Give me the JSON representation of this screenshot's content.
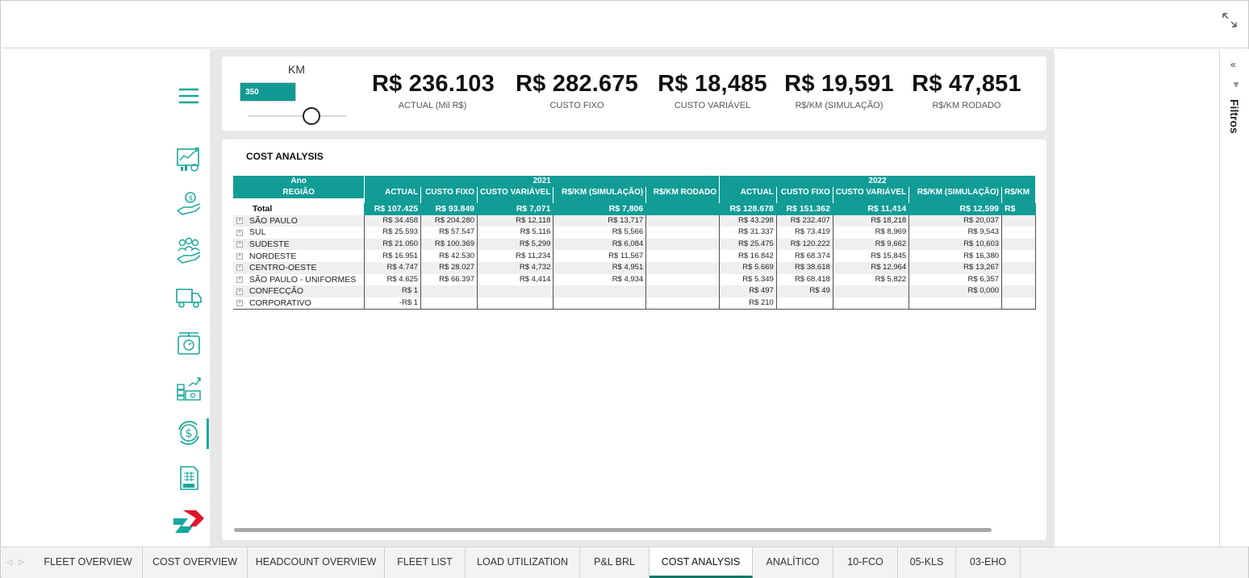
{
  "kpis": {
    "km_label": "KM",
    "km_value": "350",
    "items": [
      {
        "value": "R$ 236.103",
        "label": "ACTUAL (Mil R$)"
      },
      {
        "value": "R$ 282.675",
        "label": "CUSTO FIXO"
      },
      {
        "value": "R$ 18,485",
        "label": "CUSTO VARIÁVEL"
      },
      {
        "value": "R$ 19,591",
        "label": "R$/KM (SIMULAÇÃO)"
      },
      {
        "value": "R$ 47,851",
        "label": "R$/KM RODADO"
      }
    ]
  },
  "table": {
    "title": "COST ANALYSIS",
    "ano_label": "Ano",
    "regiao_label": "REGIÃO",
    "years": [
      "2021",
      "2022"
    ],
    "columns": [
      "ACTUAL",
      "CUSTO FIXO",
      "CUSTO VARIÁVEL",
      "R$/KM (SIMULAÇÃO)",
      "R$/KM RODADO",
      "ACTUAL",
      "CUSTO FIXO",
      "CUSTO VARIÁVEL",
      "R$/KM (SIMULAÇÃO)",
      "R$/KM"
    ],
    "total": {
      "name": "Total",
      "cells": [
        "R$ 107.425",
        "R$ 93.849",
        "R$ 7,071",
        "R$ 7,806",
        "",
        "R$ 128.678",
        "R$ 151.362",
        "R$ 11,414",
        "R$ 12,599",
        "R$"
      ]
    },
    "rows": [
      {
        "name": "SÃO PAULO",
        "cells": [
          "R$ 34.458",
          "R$ 204.280",
          "R$ 12,118",
          "R$ 13,717",
          "",
          "R$ 43.298",
          "R$ 232.407",
          "R$ 18,218",
          "R$ 20,037",
          ""
        ]
      },
      {
        "name": "SUL",
        "cells": [
          "R$ 25.593",
          "R$ 57.547",
          "R$ 5,116",
          "R$ 5,566",
          "",
          "R$ 31.337",
          "R$ 73.419",
          "R$ 8,969",
          "R$ 9,543",
          ""
        ]
      },
      {
        "name": "SUDESTE",
        "cells": [
          "R$ 21.050",
          "R$ 100.369",
          "R$ 5,299",
          "R$ 6,084",
          "",
          "R$ 25.475",
          "R$ 120.222",
          "R$ 9,662",
          "R$ 10,603",
          ""
        ]
      },
      {
        "name": "NORDESTE",
        "cells": [
          "R$ 16.951",
          "R$ 42.530",
          "R$ 11,234",
          "R$ 11,567",
          "",
          "R$ 16.842",
          "R$ 68.374",
          "R$ 15,845",
          "R$ 16,380",
          ""
        ]
      },
      {
        "name": "CENTRO-OESTE",
        "cells": [
          "R$ 4.747",
          "R$ 28.027",
          "R$ 4,732",
          "R$ 4,951",
          "",
          "R$ 5.669",
          "R$ 38.618",
          "R$ 12,964",
          "R$ 13,267",
          ""
        ]
      },
      {
        "name": "SÃO PAULO - UNIFORMES",
        "cells": [
          "R$ 4.625",
          "R$ 66.397",
          "R$ 4,414",
          "R$ 4,934",
          "",
          "R$ 5.349",
          "R$ 68.418",
          "R$ 5,822",
          "R$ 6,357",
          ""
        ]
      },
      {
        "name": "CONFECÇÃO",
        "cells": [
          "R$ 1",
          "",
          "",
          "",
          "",
          "R$ 497",
          "R$ 49",
          "",
          "R$ 0,000",
          ""
        ]
      },
      {
        "name": "CORPORATIVO",
        "cells": [
          "-R$ 1",
          "",
          "",
          "",
          "",
          "R$ 210",
          "",
          "",
          "",
          ""
        ]
      }
    ]
  },
  "filters_label": "Filtros",
  "tabs": [
    "FLEET OVERVIEW",
    "COST OVERVIEW",
    "HEADCOUNT OVERVIEW",
    "FLEET LIST",
    "LOAD UTILIZATION",
    "P&L BRL",
    "COST ANALYSIS",
    "ANALÍTICO",
    "10-FCO",
    "05-KLS",
    "03-EHO"
  ],
  "active_tab": "COST ANALYSIS",
  "colors": {
    "accent": "#129c96",
    "sidebar_icon": "#1aa89b",
    "active_tab_underline": "#117865"
  },
  "sidebar_icons": [
    "menu-icon",
    "fleet-dashboard-icon",
    "cost-hand-icon",
    "headcount-icon",
    "truck-icon",
    "scale-icon",
    "money-growth-icon",
    "dollar-cycle-icon",
    "spreadsheet-xls-icon",
    "brand-logo"
  ]
}
